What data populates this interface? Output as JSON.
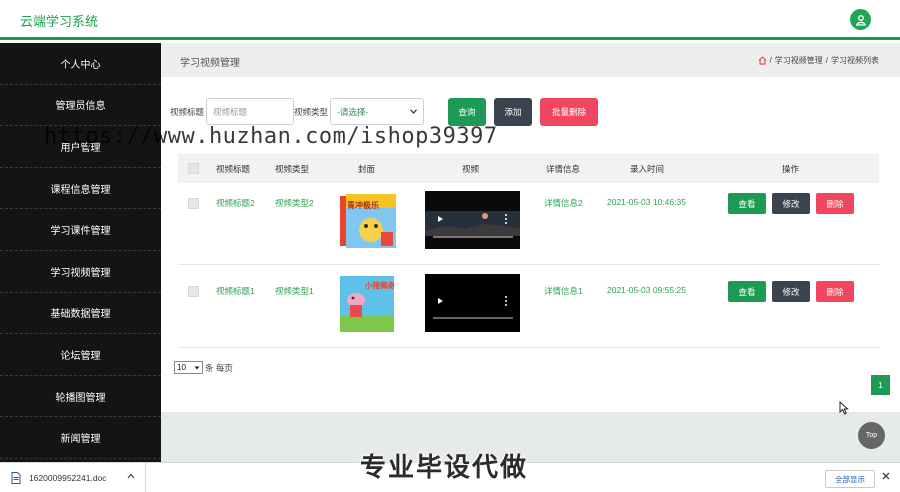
{
  "app": {
    "title": "云端学习系统"
  },
  "sidebar": {
    "items": [
      {
        "label": "个人中心"
      },
      {
        "label": "管理员信息"
      },
      {
        "label": "用户管理"
      },
      {
        "label": "课程信息管理"
      },
      {
        "label": "学习课件管理"
      },
      {
        "label": "学习视频管理"
      },
      {
        "label": "基础数据管理"
      },
      {
        "label": "论坛管理"
      },
      {
        "label": "轮播图管理"
      },
      {
        "label": "新闻管理"
      }
    ]
  },
  "page": {
    "title": "学习视频管理",
    "breadcrumb": [
      "学习视频管理",
      "学习视频列表"
    ],
    "breadcrumb_sep": "/"
  },
  "filters": {
    "title_label": "视频标题",
    "title_placeholder": "视频标题",
    "type_label": "视频类型",
    "type_selected": "-请选择-",
    "query_label": "查询",
    "add_label": "添加",
    "batch_delete_label": "批量删除"
  },
  "table": {
    "columns": [
      "视频标题",
      "视频类型",
      "封面",
      "视频",
      "详情信息",
      "录入时间",
      "操作"
    ],
    "rows": [
      {
        "title": "视频标题2",
        "type": "视频类型2",
        "cover_text": "青冲极乐",
        "detail": "详情信息2",
        "time": "2021-05-03 10:46:35",
        "actions": [
          "查看",
          "修改",
          "删除"
        ]
      },
      {
        "title": "视频标题1",
        "type": "视频类型1",
        "cover_text": "小猪佩奇",
        "detail": "详情信息1",
        "time": "2021-05-03 09:55:25",
        "actions": [
          "查看",
          "修改",
          "删除"
        ]
      }
    ]
  },
  "pagination": {
    "page_size": "10",
    "page_size_suffix": "条 每页",
    "current_page": "1"
  },
  "top_button": "Top",
  "downloads": {
    "file_name": "1620009952241.doc",
    "show_all": "全部显示"
  },
  "watermarks": {
    "url": "https://www.huzhan.com/ishop39397",
    "slogan": "专业毕设代做"
  },
  "colors": {
    "accent": "#1f9a4c",
    "sidebar_bg": "#141414",
    "danger": "#f0475f",
    "dark_button": "#3a4350"
  }
}
